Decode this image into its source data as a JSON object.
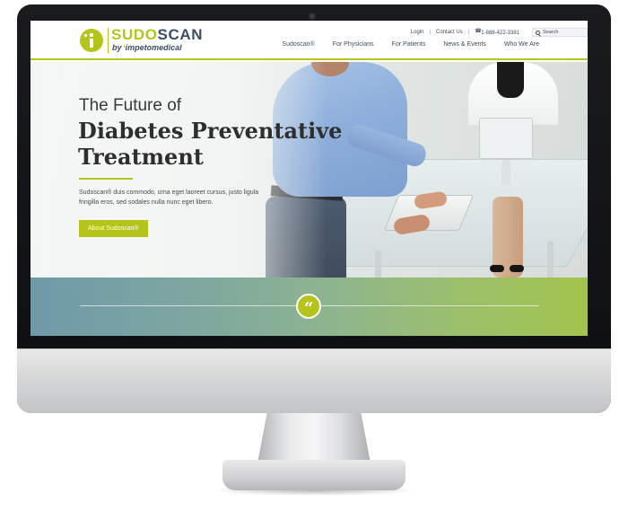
{
  "brand": {
    "name_part1": "SUDO",
    "name_part2": "SCAN",
    "tagline_by": "by",
    "tagline_company": "impetomedical"
  },
  "utility_nav": {
    "login": "Login",
    "contact": "Contact Us",
    "phone": "1-888-422-3381",
    "search_placeholder": "Search"
  },
  "main_nav": {
    "items": [
      {
        "label": "Sudoscan®"
      },
      {
        "label": "For Physicians"
      },
      {
        "label": "For Patients"
      },
      {
        "label": "News & Events"
      },
      {
        "label": "Who We Are"
      }
    ]
  },
  "hero": {
    "kicker": "The Future of",
    "title_line1": "Diabetes Preventative",
    "title_line2": "Treatment",
    "description": "Sudoscan® duis commodo, urna eget laoreet cursus, justo ligula fringilla eros, sed sodales nulla nunc eget libero.",
    "cta_label": "About Sudoscan®"
  },
  "testimonial": {
    "quote_glyph": "“"
  },
  "colors": {
    "accent": "#b5c41a",
    "navy": "#3c4e62"
  }
}
